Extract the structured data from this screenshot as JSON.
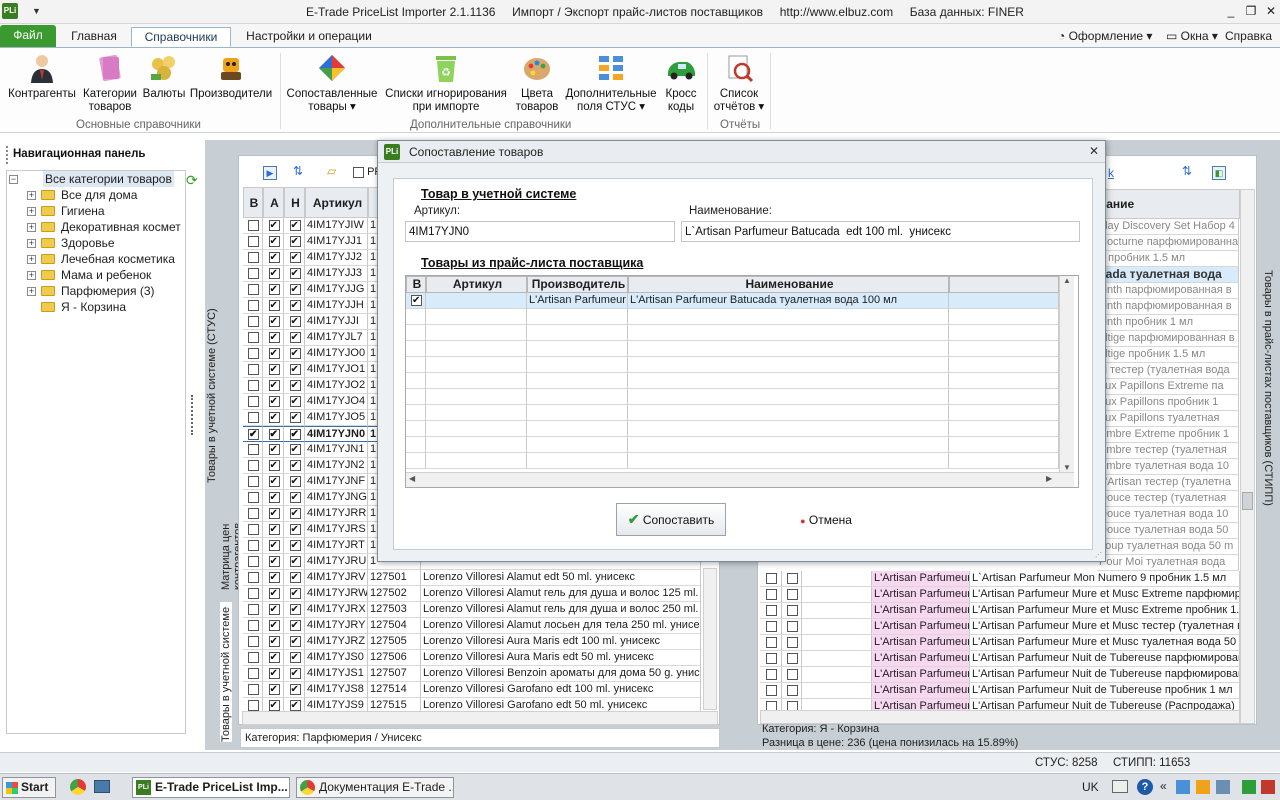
{
  "titlebar": {
    "logo": "PLi",
    "title": "E-Trade PriceList Importer 2.1.1136     Импорт / Экспорт прайс-листов поставщиков     http://www.elbuz.com     База данных: FINER",
    "min": "_",
    "restore": "❐",
    "close": "✕"
  },
  "tabs": {
    "file": "Файл",
    "home": "Главная",
    "references": "Справочники",
    "settings": "Настройки и операции",
    "appearance": "Оформление",
    "windows": "Окна",
    "help": "Справка"
  },
  "ribbon": {
    "groups": {
      "basic": "Основные справочники",
      "extra": "Дополнительные справочники",
      "reports": "Отчёты"
    },
    "items": {
      "contractors": "Контрагенты",
      "categories_1": "Категории",
      "categories_2": "товаров",
      "currencies": "Валюты",
      "manufacturers": "Производители",
      "matched_1": "Сопоставленные",
      "matched_2": "товары",
      "ignore_1": "Списки игнорирования",
      "ignore_2": "при импорте",
      "colors_1": "Цвета",
      "colors_2": "товаров",
      "fields_1": "Дополнительные",
      "fields_2": "поля СТУС",
      "cross_1": "Кросс",
      "cross_2": "коды",
      "reports_1": "Список",
      "reports_2": "отчётов"
    }
  },
  "nav": {
    "title": "Навигационная панель",
    "root": "Все категории товаров",
    "items": [
      "Все для дома",
      "Гигиена",
      "Декоративная космет",
      "Здоровье",
      "Лечебная косметика",
      "Мама и ребенок",
      "Парфюмерия (3)",
      "Я - Корзина"
    ]
  },
  "left_panel": {
    "headers": {
      "b": "В",
      "a": "А",
      "n": "Н",
      "sku": "Артикул",
      "i": "I"
    },
    "rows": [
      {
        "sku": "4IM17YJIW",
        "code": "1",
        "name": "",
        "b": false,
        "a": true,
        "n": true
      },
      {
        "sku": "4IM17YJJ1",
        "code": "1",
        "name": "",
        "b": false,
        "a": true,
        "n": true
      },
      {
        "sku": "4IM17YJJ2",
        "code": "1",
        "name": "",
        "b": false,
        "a": true,
        "n": true
      },
      {
        "sku": "4IM17YJJ3",
        "code": "1",
        "name": "",
        "b": false,
        "a": true,
        "n": true
      },
      {
        "sku": "4IM17YJJG",
        "code": "1",
        "name": "",
        "b": false,
        "a": true,
        "n": true
      },
      {
        "sku": "4IM17YJJH",
        "code": "1",
        "name": "",
        "b": false,
        "a": true,
        "n": true
      },
      {
        "sku": "4IM17YJJI",
        "code": "1",
        "name": "",
        "b": false,
        "a": true,
        "n": true
      },
      {
        "sku": "4IM17YJL7",
        "code": "1",
        "name": "",
        "b": false,
        "a": true,
        "n": true
      },
      {
        "sku": "4IM17YJO0",
        "code": "1",
        "name": "",
        "b": false,
        "a": true,
        "n": true
      },
      {
        "sku": "4IM17YJO1",
        "code": "1",
        "name": "",
        "b": false,
        "a": true,
        "n": true
      },
      {
        "sku": "4IM17YJO2",
        "code": "1",
        "name": "",
        "b": false,
        "a": true,
        "n": true
      },
      {
        "sku": "4IM17YJO4",
        "code": "1",
        "name": "",
        "b": false,
        "a": true,
        "n": true
      },
      {
        "sku": "4IM17YJO5",
        "code": "1",
        "name": "",
        "b": false,
        "a": true,
        "n": true
      },
      {
        "sku": "4IM17YJN0",
        "code": "1",
        "name": "",
        "b": true,
        "a": true,
        "n": true,
        "selected": true
      },
      {
        "sku": "4IM17YJN1",
        "code": "1",
        "name": "",
        "b": false,
        "a": true,
        "n": true
      },
      {
        "sku": "4IM17YJN2",
        "code": "1",
        "name": "",
        "b": false,
        "a": true,
        "n": true
      },
      {
        "sku": "4IM17YJNF",
        "code": "1",
        "name": "",
        "b": false,
        "a": true,
        "n": true
      },
      {
        "sku": "4IM17YJNG",
        "code": "1",
        "name": "",
        "b": false,
        "a": true,
        "n": true
      },
      {
        "sku": "4IM17YJRR",
        "code": "1",
        "name": "",
        "b": false,
        "a": true,
        "n": true
      },
      {
        "sku": "4IM17YJRS",
        "code": "1",
        "name": "",
        "b": false,
        "a": true,
        "n": true
      },
      {
        "sku": "4IM17YJRT",
        "code": "1",
        "name": "",
        "b": false,
        "a": true,
        "n": true
      },
      {
        "sku": "4IM17YJRU",
        "code": "1",
        "name": "",
        "b": false,
        "a": true,
        "n": true
      },
      {
        "sku": "4IM17YJRV",
        "code": "127501",
        "name": "Lorenzo Villoresi Alamut  edt 50 ml.  унисекс",
        "b": false,
        "a": true,
        "n": true
      },
      {
        "sku": "4IM17YJRW",
        "code": "127502",
        "name": "Lorenzo Villoresi Alamut  гель для душа и волос 125 ml.",
        "b": false,
        "a": true,
        "n": true
      },
      {
        "sku": "4IM17YJRX",
        "code": "127503",
        "name": "Lorenzo Villoresi Alamut  гель для душа и волос 250 ml.",
        "b": false,
        "a": true,
        "n": true
      },
      {
        "sku": "4IM17YJRY",
        "code": "127504",
        "name": "Lorenzo Villoresi Alamut  лосьен для тела 250 ml.  унисек",
        "b": false,
        "a": true,
        "n": true
      },
      {
        "sku": "4IM17YJRZ",
        "code": "127505",
        "name": "Lorenzo Villoresi Aura Maris  edt 100 ml.  унисекс",
        "b": false,
        "a": true,
        "n": true
      },
      {
        "sku": "4IM17YJS0",
        "code": "127506",
        "name": "Lorenzo Villoresi Aura Maris  edt 50 ml.  унисекс",
        "b": false,
        "a": true,
        "n": true
      },
      {
        "sku": "4IM17YJS1",
        "code": "127507",
        "name": "Lorenzo Villoresi Benzoin  ароматы для дома 50 g.  унисе",
        "b": false,
        "a": true,
        "n": true
      },
      {
        "sku": "4IM17YJS8",
        "code": "127514",
        "name": "Lorenzo Villoresi Garofano  edt 100 ml.  унисекс",
        "b": false,
        "a": true,
        "n": true
      },
      {
        "sku": "4IM17YJS9",
        "code": "127515",
        "name": "Lorenzo Villoresi Garofano  edt 50 ml.  унисекс",
        "b": false,
        "a": true,
        "n": true
      }
    ],
    "checkbox_label": "PF",
    "vtab_1": "Товары в учетной системе (СТУС)",
    "vtab_2": "Матрица цен контрагентов",
    "vtab_3": "Товары в учетной системе",
    "footer": "Категория: Парфюмерия / Унисекс"
  },
  "right_panel": {
    "header_name": "вание",
    "link": "k",
    "vtab": "Товары в прайс-листах поставщиков (СТИПП)",
    "top_names": [
      "iday Discovery Set Набор 4",
      "Nocturne парфюмированна",
      "а пробник 1.5 мл",
      "cada туалетная вода",
      "sinth парфюмированная в",
      "sinth парфюмированная в",
      "sinth пробник 1 мл",
      "oltige парфюмированная в",
      "oltige пробник 1.5 мл",
      "si тестер (туалетная вода",
      " aux Papillons Extreme па",
      " aux Papillons пробник 1",
      " aux Papillons туалетная",
      "Ambre Extreme пробник 1",
      "Ambre тестер (туалетная",
      "Ambre туалетная вода 10",
      "L'Artisan тестер (туалетна",
      " Douce тестер (туалетная",
      " Douce туалетная вода 10",
      " Douce туалетная вода 50",
      " Loup туалетная вода 50 m",
      "Pour Moi туалетная вода"
    ],
    "rows": [
      {
        "maker": "L'Artisan Parfumeur",
        "name": "L`Artisan Parfumeur Mon Numero 9 пробник 1.5 мл"
      },
      {
        "maker": "L'Artisan Parfumeur",
        "name": "L'Artisan Parfumeur Mure et Musc Extreme парфюмиров"
      },
      {
        "maker": "L'Artisan Parfumeur",
        "name": "L'Artisan Parfumeur Mure et Musc Extreme пробник 1.5"
      },
      {
        "maker": "L'Artisan Parfumeur",
        "name": "L'Artisan Parfumeur Mure et Musc тестер (туалетная в"
      },
      {
        "maker": "L'Artisan Parfumeur",
        "name": "L'Artisan Parfumeur Mure et Musc туалетная вода 50 м"
      },
      {
        "maker": "L'Artisan Parfumeur",
        "name": "L'Artisan Parfumeur Nuit de Tubereuse парфюмированн"
      },
      {
        "maker": "L'Artisan Parfumeur",
        "name": "L'Artisan Parfumeur Nuit de Tubereuse парфюмированн"
      },
      {
        "maker": "L'Artisan Parfumeur",
        "name": "L'Artisan Parfumeur Nuit de Tubereuse пробник 1 мл"
      },
      {
        "maker": "L'Artisan Parfumeur",
        "name": "L'Artisan Parfumeur Nuit de Tubereuse (Распродажа)"
      }
    ],
    "footer_1": "Категория: Я - Корзина",
    "footer_2": "Разница в цене: 236  (цена понизилась на 15.89%)"
  },
  "dialog": {
    "logo": "PLi",
    "title": "Сопоставление товаров",
    "close": "✕",
    "section_1": "Товар в учетной системе",
    "sku_label": "Артикул:",
    "name_label": "Наименование:",
    "sku_value": "4IM17YJN0",
    "name_value": "L`Artisan Parfumeur Batucada  edt 100 ml.  унисекс",
    "section_2": "Товары из прайс-листа поставщика",
    "grid_headers": {
      "b": "В",
      "sku": "Артикул",
      "maker": "Производитель",
      "name": "Наименование"
    },
    "grid_rows": [
      {
        "checked": true,
        "sku": "",
        "maker": "L'Artisan Parfumeur",
        "name": "L'Artisan Parfumeur Batucada туалетная вода 100 мл"
      }
    ],
    "match_button": "Сопоставить",
    "cancel_button": "Отмена"
  },
  "statusbar": {
    "stus": "СТУС: 8258",
    "stipp": "СТИПП: 11653"
  },
  "taskbar": {
    "start": "Start",
    "task_1": "E-Trade PriceList Imp...",
    "task_2": "Документация E-Trade ...",
    "lang": "UK",
    "tray_arrows": "«"
  },
  "colors": {
    "file_tab": "#3a9a2f",
    "accent": "#1e395b",
    "maker_cell": "#f8d8f0",
    "selected_row": "#d7ebfa"
  }
}
